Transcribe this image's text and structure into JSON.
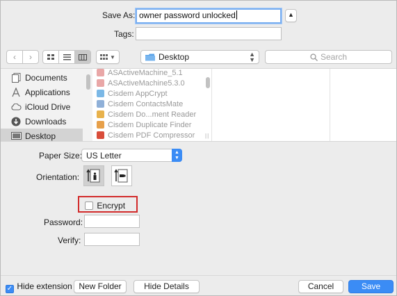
{
  "save": {
    "save_as_label": "Save As:",
    "filename": "owner password unlocked",
    "tags_label": "Tags:",
    "tags_value": ""
  },
  "toolbar": {
    "location": "Desktop",
    "search_placeholder": "Search"
  },
  "sidebar": {
    "items": [
      {
        "label": "Documents",
        "icon": "documents-icon"
      },
      {
        "label": "Applications",
        "icon": "applications-icon"
      },
      {
        "label": "iCloud Drive",
        "icon": "cloud-icon"
      },
      {
        "label": "Downloads",
        "icon": "downloads-icon"
      },
      {
        "label": "Desktop",
        "icon": "desktop-icon"
      }
    ]
  },
  "files": [
    {
      "name": "ASActiveMachine_5.1",
      "color": "#e9a7a7"
    },
    {
      "name": "ASActiveMachine5.3.0",
      "color": "#e9a7a7"
    },
    {
      "name": "Cisdem AppCrypt",
      "color": "#7bb8e6"
    },
    {
      "name": "Cisdem ContactsMate",
      "color": "#8fb0d8"
    },
    {
      "name": "Cisdem Do...ment Reader",
      "color": "#e8b24c"
    },
    {
      "name": "Cisdem Duplicate Finder",
      "color": "#e7a04a"
    },
    {
      "name": "Cisdem PDF Compressor",
      "color": "#d94d3a"
    }
  ],
  "print": {
    "paper_size_label": "Paper Size:",
    "paper_size_value": "US Letter",
    "orientation_label": "Orientation:",
    "encrypt_label": "Encrypt",
    "password_label": "Password:",
    "verify_label": "Verify:"
  },
  "footer": {
    "hide_extension_label": "Hide extension",
    "new_folder_label": "New Folder",
    "hide_details_label": "Hide Details",
    "cancel_label": "Cancel",
    "save_label": "Save"
  },
  "colors": {
    "accent": "#3b8cf5",
    "highlight_box": "#d22a2a"
  }
}
